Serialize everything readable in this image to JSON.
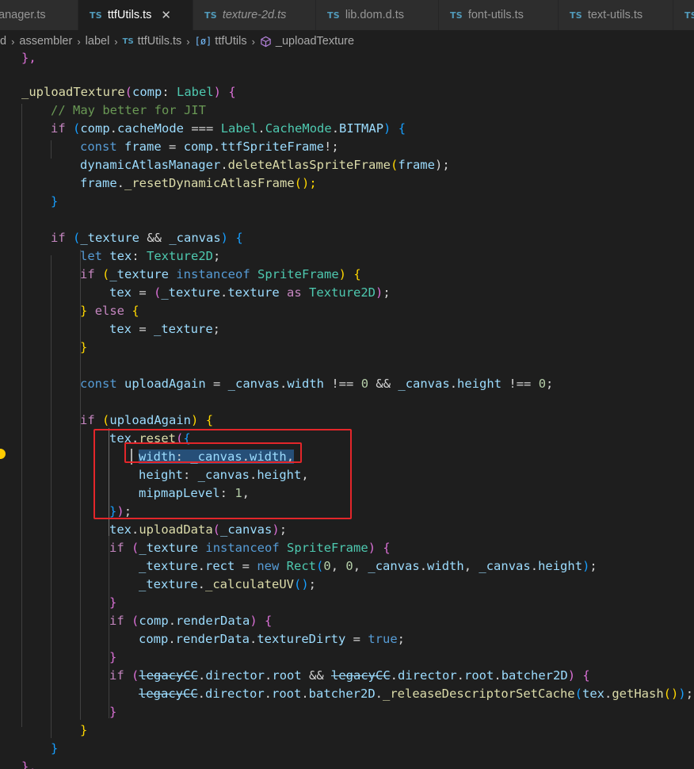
{
  "tabs": [
    {
      "name": "anager.ts",
      "active": false,
      "italic": false
    },
    {
      "name": "ttfUtils.ts",
      "active": true,
      "italic": false
    },
    {
      "name": "texture-2d.ts",
      "active": false,
      "italic": true
    },
    {
      "name": "lib.dom.d.ts",
      "active": false,
      "italic": false
    },
    {
      "name": "font-utils.ts",
      "active": false,
      "italic": false
    },
    {
      "name": "text-utils.ts",
      "active": false,
      "italic": false
    }
  ],
  "tab_badge": "TS",
  "close_glyph": "✕",
  "breadcrumbs": {
    "items": [
      "d",
      "assembler",
      "label",
      "ttfUtils.ts",
      "ttfUtils",
      "_uploadTexture"
    ]
  },
  "code": {
    "l01": {
      "a": "},"
    },
    "l03": {
      "a": "_uploadTexture",
      "b": "(",
      "c": "comp",
      "d": ": ",
      "e": "Label",
      "f": ")",
      "g": " {"
    },
    "l04": {
      "a": "// May better for JIT"
    },
    "l05": {
      "a": "if",
      "b": " (",
      "c": "comp",
      "d": ".",
      "e": "cacheMode",
      "f": " === ",
      "g": "Label",
      "h": ".",
      "i": "CacheMode",
      "j": ".",
      "k": "BITMAP",
      "l": ") {"
    },
    "l06": {
      "a": "const",
      "b": " ",
      "c": "frame",
      "d": " = ",
      "e": "comp",
      "f": ".",
      "g": "ttfSpriteFrame",
      "h": "!;"
    },
    "l07": {
      "a": "dynamicAtlasManager",
      "b": ".",
      "c": "deleteAtlasSpriteFrame",
      "d": "(",
      "e": "frame",
      "f": ");"
    },
    "l08": {
      "a": "frame",
      "b": ".",
      "c": "_resetDynamicAtlasFrame",
      "d": "();"
    },
    "l09": {
      "a": "}"
    },
    "l11": {
      "a": "if",
      "b": " (",
      "c": "_texture",
      "d": " && ",
      "e": "_canvas",
      "f": ") {"
    },
    "l12": {
      "a": "let",
      "b": " ",
      "c": "tex",
      "d": ": ",
      "e": "Texture2D",
      "f": ";"
    },
    "l13": {
      "a": "if",
      "b": " (",
      "c": "_texture",
      "d": " ",
      "e": "instanceof",
      "f": " ",
      "g": "SpriteFrame",
      "h": ")",
      "i": " {"
    },
    "l14": {
      "a": "tex",
      "b": " = ",
      "c": "(",
      "d": "_texture",
      "e": ".",
      "f": "texture",
      "g": " ",
      "h": "as",
      "i": " ",
      "j": "Texture2D",
      "k": ")",
      "l": ";"
    },
    "l15": {
      "a": "}",
      "b": " ",
      "c": "else",
      "d": " {"
    },
    "l16": {
      "a": "tex",
      "b": " = ",
      "c": "_texture",
      "d": ";"
    },
    "l17": {
      "a": "}"
    },
    "l19": {
      "a": "const",
      "b": " ",
      "c": "uploadAgain",
      "d": " = ",
      "e": "_canvas",
      "f": ".",
      "g": "width",
      "h": " !== ",
      "i": "0",
      "j": " && ",
      "k": "_canvas",
      "l": ".",
      "m": "height",
      "n": " !== ",
      "o": "0",
      "p": ";"
    },
    "l21": {
      "a": "if",
      "b": " ",
      "c": "(",
      "d": "uploadAgain",
      "e": ")",
      "f": " {"
    },
    "l22": {
      "a": "tex",
      "b": ".",
      "c": "reset",
      "d": "(",
      "e": "{"
    },
    "l23": {
      "a": "width",
      "b": ": ",
      "c": "_canvas",
      "d": ".",
      "e": "width",
      "f": ","
    },
    "l24": {
      "a": "height",
      "b": ": ",
      "c": "_canvas",
      "d": ".",
      "e": "height",
      "f": ","
    },
    "l25": {
      "a": "mipmapLevel",
      "b": ": ",
      "c": "1",
      "d": ","
    },
    "l26": {
      "a": "}",
      "b": ")",
      "c": ";"
    },
    "l27": {
      "a": "tex",
      "b": ".",
      "c": "uploadData",
      "d": "(",
      "e": "_canvas",
      "f": ")",
      "g": ";"
    },
    "l28": {
      "a": "if",
      "b": " ",
      "c": "(",
      "d": "_texture",
      "e": " ",
      "f": "instanceof",
      "g": " ",
      "h": "SpriteFrame",
      "i": ")",
      "j": " {"
    },
    "l29": {
      "a": "_texture",
      "b": ".",
      "c": "rect",
      "d": " = ",
      "e": "new",
      "f": " ",
      "g": "Rect",
      "h": "(",
      "i": "0",
      "j": ", ",
      "k": "0",
      "l": ", ",
      "m": "_canvas",
      "n": ".",
      "o": "width",
      "p": ", ",
      "q": "_canvas",
      "r": ".",
      "s": "height",
      "t": ")",
      "u": ";"
    },
    "l30": {
      "a": "_texture",
      "b": ".",
      "c": "_calculateUV",
      "d": "()",
      "e": ";"
    },
    "l31": {
      "a": "}"
    },
    "l32": {
      "a": "if",
      "b": " ",
      "c": "(",
      "d": "comp",
      "e": ".",
      "f": "renderData",
      "g": ")",
      "h": " {"
    },
    "l33": {
      "a": "comp",
      "b": ".",
      "c": "renderData",
      "d": ".",
      "e": "textureDirty",
      "f": " = ",
      "g": "true",
      "h": ";"
    },
    "l34": {
      "a": "}"
    },
    "l35": {
      "a": "if",
      "b": " ",
      "c": "(",
      "d": "legacyCC",
      "e": ".",
      "f": "director",
      "g": ".",
      "h": "root",
      "i": " && ",
      "j": "legacyCC",
      "k": ".",
      "l": "director",
      "m": ".",
      "n": "root",
      "o": ".",
      "p": "batcher2D",
      "q": ")",
      "r": " {"
    },
    "l36": {
      "a": "legacyCC",
      "b": ".",
      "c": "director",
      "d": ".",
      "e": "root",
      "f": ".",
      "g": "batcher2D",
      "h": ".",
      "i": "_releaseDescriptorSetCache",
      "j": "(",
      "k": "tex",
      "l": ".",
      "m": "getHash",
      "n": "()",
      "o": ")",
      "p": ";"
    },
    "l37": {
      "a": "}"
    },
    "l38": {
      "a": "}"
    },
    "l39": {
      "a": "}"
    },
    "l40": {
      "a": "},"
    }
  },
  "colors": {
    "keyword": "#569cd6",
    "control": "#c586c0",
    "function": "#dcdcaa",
    "variable": "#9cdcfe",
    "type": "#4ec9b0",
    "number": "#b5cea8",
    "comment": "#6a9955",
    "highlight_box": "#e3262a",
    "selection": "#264f78"
  }
}
